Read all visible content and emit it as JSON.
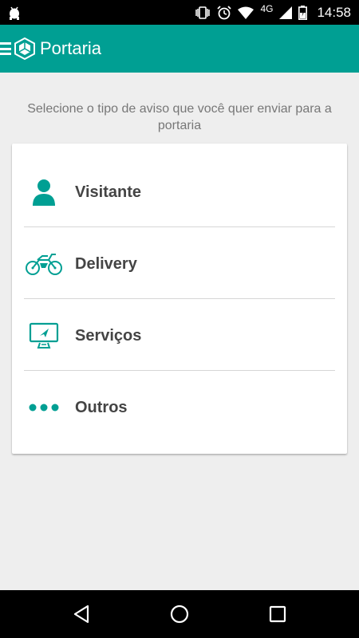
{
  "status_bar": {
    "network": "4G",
    "time": "14:58"
  },
  "app_bar": {
    "title": "Portaria"
  },
  "instruction": "Selecione o tipo de aviso que você quer enviar para a portaria",
  "options": [
    {
      "label": "Visitante",
      "icon": "person-icon"
    },
    {
      "label": "Delivery",
      "icon": "motorcycle-icon"
    },
    {
      "label": "Serviços",
      "icon": "monitor-icon"
    },
    {
      "label": "Outros",
      "icon": "more-dots-icon"
    }
  ],
  "colors": {
    "primary": "#009f93",
    "background": "#eeeeee",
    "text": "#444444"
  }
}
